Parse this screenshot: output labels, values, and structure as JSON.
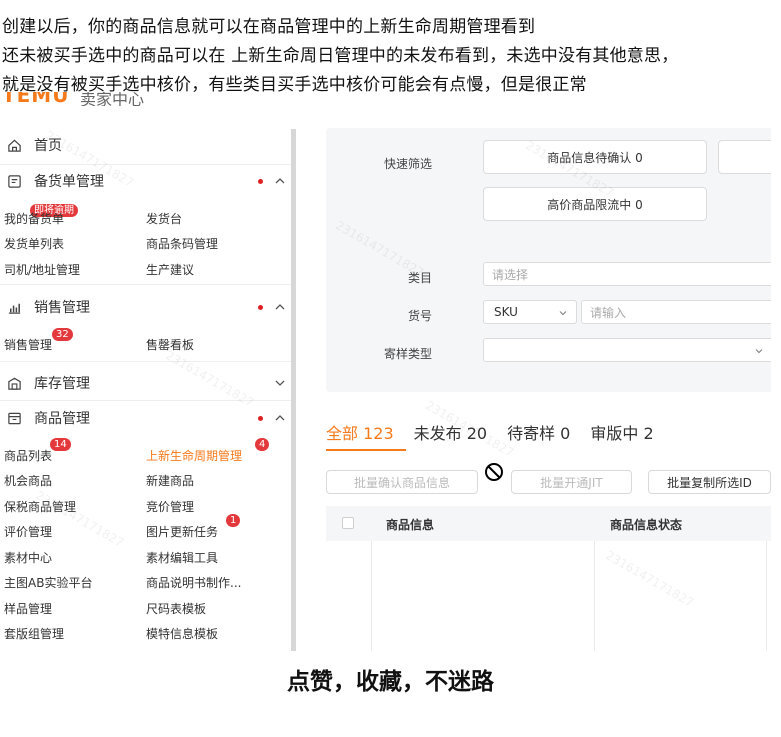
{
  "annotation": {
    "line1": "创建以后，你的商品信息就可以在商品管理中的上新生命周期管理看到",
    "line2": "还未被买手选中的商品可以在 上新生命周日管理中的未发布看到，未选中没有其他意思，",
    "line3": "就是没有被买手选中核价，有些类目买手选中核价可能会有点慢，但是很正常"
  },
  "header": {
    "brand": "TEMU",
    "brand_sub": "卖家中心"
  },
  "sidebar": {
    "home": "首页",
    "groups": [
      {
        "title": "备货单管理",
        "icon": "document-icon",
        "links": [
          "我的备货单",
          "发货台",
          "发货单列表",
          "商品条码管理",
          "司机/地址管理",
          "生产建议"
        ],
        "badge": "即将逾期"
      },
      {
        "title": "销售管理",
        "icon": "bar-chart-icon",
        "links": [
          "销售管理",
          "售罄看板"
        ],
        "badge": "32"
      },
      {
        "title": "库存管理",
        "icon": "warehouse-icon",
        "links": []
      },
      {
        "title": "商品管理",
        "icon": "product-icon",
        "links": [
          "商品列表",
          "上新生命周期管理",
          "机会商品",
          "新建商品",
          "保税商品管理",
          "竞价管理",
          "评价管理",
          "图片更新任务",
          "素材中心",
          "素材编辑工具",
          "主图AB实验平台",
          "商品说明书制作...",
          "样品管理",
          "尺码表模板",
          "套版组管理",
          "模特信息模板"
        ],
        "badges": {
          "list": "14",
          "lifecycle": "4",
          "image_task": "1"
        }
      }
    ]
  },
  "filters": {
    "quick_label": "快速筛选",
    "quick_chips": [
      "商品信息待确认 0",
      "高价商品限流中 0"
    ],
    "category_label": "类目",
    "category_placeholder": "请选择",
    "sku_label": "货号",
    "sku_select": "SKU",
    "sku_placeholder": "请输入",
    "sample_label": "寄样类型"
  },
  "tabs": [
    "全部 123",
    "未发布 20",
    "待寄样 0",
    "审版中 2"
  ],
  "actions": [
    "批量确认商品信息",
    "批量开通JIT",
    "批量复制所选ID"
  ],
  "table": {
    "columns": [
      "商品信息",
      "商品信息状态"
    ]
  },
  "watermark": "2316147171827",
  "footer": "点赞，收藏，不迷路"
}
